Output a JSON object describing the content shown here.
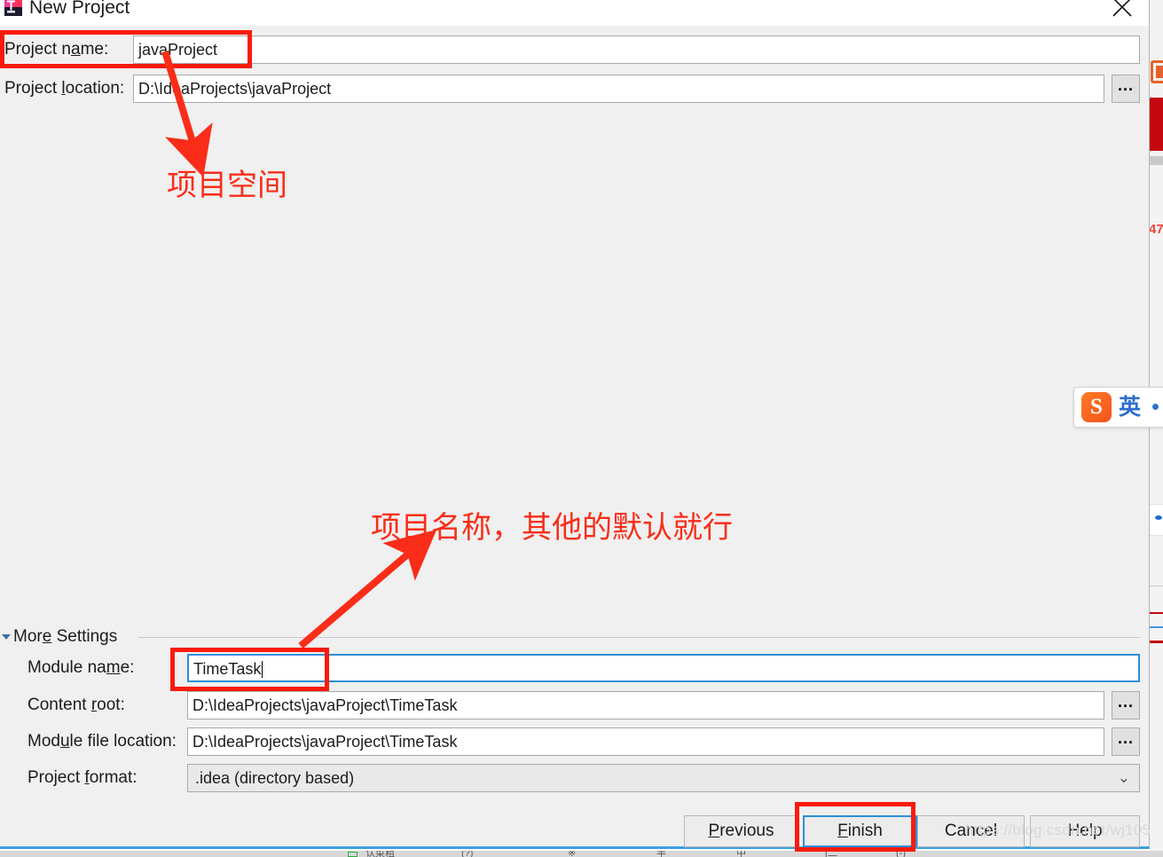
{
  "dialog": {
    "title": "New Project",
    "icon": "intellij-idea-icon",
    "close_icon": "close-icon",
    "fields": [
      {
        "id": "project-name",
        "label": "Project name:",
        "label_pre": "Project n",
        "label_mnemonic": "a",
        "label_post": "me:",
        "value": "javaProject",
        "has_browse": false
      },
      {
        "id": "project-location",
        "label": "Project location:",
        "label_pre": "Project ",
        "label_mnemonic": "l",
        "label_post": "ocation:",
        "value": "D:\\IdeaProjects\\javaProject",
        "has_browse": true,
        "browse_label": "..."
      }
    ],
    "more_settings": {
      "label": "More Settings",
      "label_pre": "Mor",
      "label_mnemonic": "e",
      "label_post": " Settings",
      "expanded": true,
      "triangle_icon": "chevron-down-icon",
      "fields": [
        {
          "id": "module-name",
          "label": "Module name:",
          "label_pre": "Module na",
          "label_mnemonic": "m",
          "label_post": "e:",
          "value": "TimeTask",
          "focused": true,
          "has_browse": false
        },
        {
          "id": "content-root",
          "label": "Content root:",
          "label_pre": "Content ",
          "label_mnemonic": "r",
          "label_post": "oot:",
          "value": "D:\\IdeaProjects\\javaProject\\TimeTask",
          "has_browse": true,
          "browse_label": "..."
        },
        {
          "id": "module-file-location",
          "label": "Module file location:",
          "label_pre": "Mod",
          "label_mnemonic": "u",
          "label_post": "le file location:",
          "value": "D:\\IdeaProjects\\javaProject\\TimeTask",
          "has_browse": true,
          "browse_label": "..."
        },
        {
          "id": "project-format",
          "label": "Project format:",
          "label_pre": "Project ",
          "label_mnemonic": "f",
          "label_post": "ormat:",
          "value": ".idea (directory based)",
          "type": "combobox",
          "chevron": "⌄"
        }
      ]
    },
    "buttons": [
      {
        "id": "previous",
        "label": "Previous",
        "pre": "",
        "mnemonic": "P",
        "post": "revious",
        "default": false
      },
      {
        "id": "finish",
        "label": "Finish",
        "pre": "",
        "mnemonic": "F",
        "post": "inish",
        "default": true
      },
      {
        "id": "cancel",
        "label": "Cancel",
        "pre": "Cancel",
        "mnemonic": "",
        "post": "",
        "default": false
      },
      {
        "id": "help",
        "label": "Help",
        "pre": "Help",
        "mnemonic": "",
        "post": "",
        "default": false
      }
    ]
  },
  "annotations": {
    "color": "#fa2d19",
    "box_color": "#fa1a0c",
    "note_top": "项目空间",
    "note_bottom": "项目名称，其他的默认就行"
  },
  "ime": {
    "logo": "S",
    "mode": "英",
    "logo_name": "sogou-logo-icon"
  },
  "watermark": {
    "text": "https://blog.csdn.net/wj105"
  },
  "taskbar": {
    "items": [
      "认菜粗",
      "(?)",
      "※",
      "半",
      "中",
      "[二",
      "(-)"
    ]
  }
}
